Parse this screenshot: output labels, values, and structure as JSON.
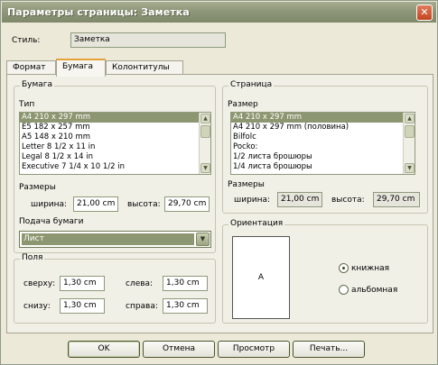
{
  "window": {
    "title": "Параметры страницы: Заметка",
    "close_glyph": "✕"
  },
  "style_row": {
    "label": "Стиль:",
    "value": "Заметка"
  },
  "tabs": [
    {
      "label": "Формат"
    },
    {
      "label": "Бумага"
    },
    {
      "label": "Колонтитулы"
    }
  ],
  "paper": {
    "group_title": "Бумага",
    "type_label": "Тип",
    "type_items": [
      "A4 210 x 297 mm",
      "E5 182 x 257 mm",
      "A5 148 x 210 mm",
      "Letter 8 1/2 x 11 in",
      "Legal 8 1/2 x 14 in",
      "Executive 7 1/4 x 10 1/2 in"
    ],
    "type_selected_index": 0,
    "sizes_label": "Размеры",
    "width_label": "ширина:",
    "width_value": "21,00 cm",
    "height_label": "высота:",
    "height_value": "29,70 cm",
    "feed_label": "Подача бумаги",
    "feed_value": "Лист"
  },
  "margins": {
    "group_title": "Поля",
    "top_label": "сверху:",
    "top_value": "1,30 cm",
    "left_label": "слева:",
    "left_value": "1,30 cm",
    "bottom_label": "снизу:",
    "bottom_value": "1,30 cm",
    "right_label": "справа:",
    "right_value": "1,30 cm"
  },
  "page": {
    "group_title": "Страница",
    "size_label": "Размер",
    "size_items": [
      "A4 210 x 297 mm",
      "A4 210 x 297 mm (половина)",
      "Bilfolc",
      "Pocko:",
      "1/2 листа брошюры",
      "1/4 листа брошюры"
    ],
    "size_selected_index": 0,
    "sizes_label": "Размеры",
    "width_label": "ширина:",
    "width_value": "21,00 cm",
    "height_label": "высота:",
    "height_value": "29,70 cm"
  },
  "orientation": {
    "group_title": "Ориентация",
    "preview_letter": "A",
    "portrait_label": "книжная",
    "landscape_label": "альбомная",
    "selected": "portrait"
  },
  "buttons": {
    "ok": "OK",
    "cancel": "Отмена",
    "preview": "Просмотр",
    "print": "Печать..."
  },
  "scroll_glyphs": {
    "up": "▲",
    "down": "▼"
  },
  "colors": {
    "selection": "#8c9670",
    "title_bar": "#8e977a",
    "close_button": "#c2451e",
    "active_tab_accent": "#e6a13a"
  }
}
